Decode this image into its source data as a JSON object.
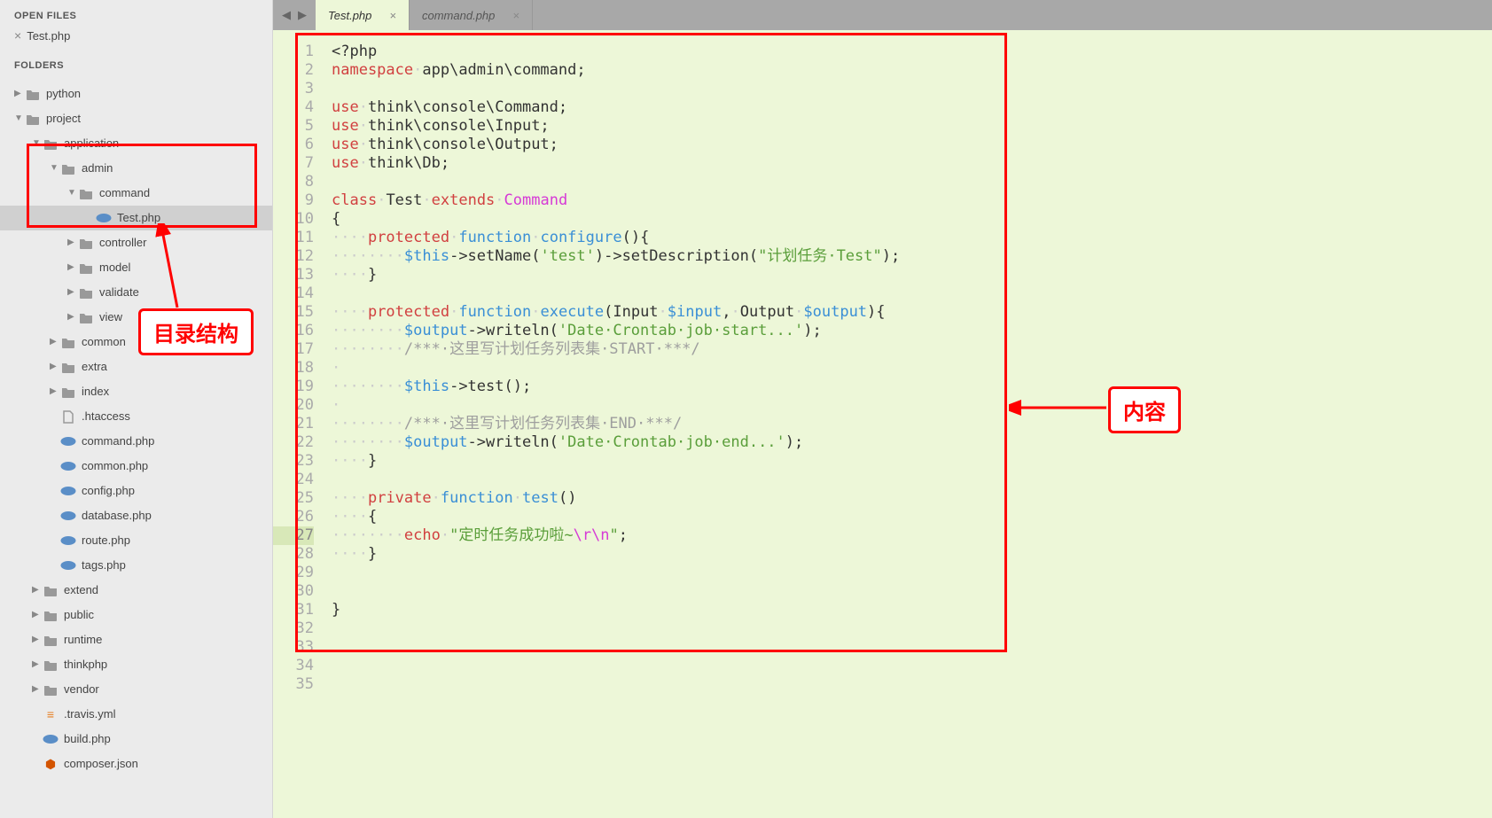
{
  "sidebar": {
    "open_files_header": "OPEN FILES",
    "open_files": [
      {
        "name": "Test.php"
      }
    ],
    "folders_header": "FOLDERS",
    "tree": [
      {
        "label": "python",
        "type": "folder",
        "arrow": "▶",
        "indent": 0
      },
      {
        "label": "project",
        "type": "folder",
        "arrow": "▼",
        "indent": 0
      },
      {
        "label": "application",
        "type": "folder",
        "arrow": "▼",
        "indent": 1
      },
      {
        "label": "admin",
        "type": "folder",
        "arrow": "▼",
        "indent": 2
      },
      {
        "label": "command",
        "type": "folder",
        "arrow": "▼",
        "indent": 3
      },
      {
        "label": "Test.php",
        "type": "php",
        "arrow": "",
        "indent": 4,
        "selected": true
      },
      {
        "label": "controller",
        "type": "folder",
        "arrow": "▶",
        "indent": 3
      },
      {
        "label": "model",
        "type": "folder",
        "arrow": "▶",
        "indent": 3
      },
      {
        "label": "validate",
        "type": "folder",
        "arrow": "▶",
        "indent": 3
      },
      {
        "label": "view",
        "type": "folder",
        "arrow": "▶",
        "indent": 3
      },
      {
        "label": "common",
        "type": "folder",
        "arrow": "▶",
        "indent": 2
      },
      {
        "label": "extra",
        "type": "folder",
        "arrow": "▶",
        "indent": 2
      },
      {
        "label": "index",
        "type": "folder",
        "arrow": "▶",
        "indent": 2
      },
      {
        "label": ".htaccess",
        "type": "file",
        "arrow": "",
        "indent": 2
      },
      {
        "label": "command.php",
        "type": "php",
        "arrow": "",
        "indent": 2
      },
      {
        "label": "common.php",
        "type": "php",
        "arrow": "",
        "indent": 2
      },
      {
        "label": "config.php",
        "type": "php",
        "arrow": "",
        "indent": 2
      },
      {
        "label": "database.php",
        "type": "php",
        "arrow": "",
        "indent": 2
      },
      {
        "label": "route.php",
        "type": "php",
        "arrow": "",
        "indent": 2
      },
      {
        "label": "tags.php",
        "type": "php",
        "arrow": "",
        "indent": 2
      },
      {
        "label": "extend",
        "type": "folder",
        "arrow": "▶",
        "indent": 1
      },
      {
        "label": "public",
        "type": "folder",
        "arrow": "▶",
        "indent": 1
      },
      {
        "label": "runtime",
        "type": "folder",
        "arrow": "▶",
        "indent": 1
      },
      {
        "label": "thinkphp",
        "type": "folder",
        "arrow": "▶",
        "indent": 1
      },
      {
        "label": "vendor",
        "type": "folder",
        "arrow": "▶",
        "indent": 1
      },
      {
        "label": ".travis.yml",
        "type": "yml",
        "arrow": "",
        "indent": 1
      },
      {
        "label": "build.php",
        "type": "php",
        "arrow": "",
        "indent": 1
      },
      {
        "label": "composer.json",
        "type": "json",
        "arrow": "",
        "indent": 1
      }
    ]
  },
  "tabs": [
    {
      "label": "Test.php",
      "active": true
    },
    {
      "label": "command.php",
      "active": false
    }
  ],
  "annotations": {
    "dir_structure": "目录结构",
    "content": "内容"
  },
  "code": {
    "highlighted_line": 27,
    "lines": [
      {
        "n": 1,
        "tokens": [
          [
            "<?php",
            ""
          ]
        ]
      },
      {
        "n": 2,
        "tokens": [
          [
            "namespace",
            "k-red"
          ],
          [
            "·",
            "dot"
          ],
          [
            "app\\admin\\command",
            ""
          ],
          [
            ";",
            ""
          ]
        ]
      },
      {
        "n": 3,
        "tokens": [
          [
            "",
            ""
          ]
        ]
      },
      {
        "n": 4,
        "tokens": [
          [
            "use",
            "k-red"
          ],
          [
            "·",
            "dot"
          ],
          [
            "think\\console\\Command",
            ""
          ],
          [
            ";",
            ""
          ]
        ]
      },
      {
        "n": 5,
        "tokens": [
          [
            "use",
            "k-red"
          ],
          [
            "·",
            "dot"
          ],
          [
            "think\\console\\Input",
            ""
          ],
          [
            ";",
            ""
          ]
        ]
      },
      {
        "n": 6,
        "tokens": [
          [
            "use",
            "k-red"
          ],
          [
            "·",
            "dot"
          ],
          [
            "think\\console\\Output",
            ""
          ],
          [
            ";",
            ""
          ]
        ]
      },
      {
        "n": 7,
        "tokens": [
          [
            "use",
            "k-red"
          ],
          [
            "·",
            "dot"
          ],
          [
            "think\\Db",
            ""
          ],
          [
            ";",
            ""
          ]
        ]
      },
      {
        "n": 8,
        "tokens": [
          [
            "",
            ""
          ]
        ]
      },
      {
        "n": 9,
        "tokens": [
          [
            "class",
            "k-red"
          ],
          [
            "·",
            "dot"
          ],
          [
            "Test",
            ""
          ],
          [
            "·",
            "dot"
          ],
          [
            "extends",
            "k-red"
          ],
          [
            "·",
            "dot"
          ],
          [
            "Command",
            "k-mag"
          ]
        ]
      },
      {
        "n": 10,
        "tokens": [
          [
            "{",
            ""
          ]
        ]
      },
      {
        "n": 11,
        "tokens": [
          [
            "····",
            "dot"
          ],
          [
            "protected",
            "k-red"
          ],
          [
            "·",
            "dot"
          ],
          [
            "function",
            "k-blue"
          ],
          [
            "·",
            "dot"
          ],
          [
            "configure",
            "k-blue"
          ],
          [
            "(){",
            ""
          ]
        ]
      },
      {
        "n": 12,
        "tokens": [
          [
            "········",
            "dot"
          ],
          [
            "$this",
            "k-blue"
          ],
          [
            "->setName(",
            ""
          ],
          [
            "'test'",
            "k-green"
          ],
          [
            ")->setDescription(",
            ""
          ],
          [
            "\"计划任务·Test\"",
            "k-green"
          ],
          [
            ");",
            ""
          ]
        ]
      },
      {
        "n": 13,
        "tokens": [
          [
            "····",
            "dot"
          ],
          [
            "}",
            ""
          ]
        ]
      },
      {
        "n": 14,
        "tokens": [
          [
            "",
            ""
          ]
        ]
      },
      {
        "n": 15,
        "tokens": [
          [
            "····",
            "dot"
          ],
          [
            "protected",
            "k-red"
          ],
          [
            "·",
            "dot"
          ],
          [
            "function",
            "k-blue"
          ],
          [
            "·",
            "dot"
          ],
          [
            "execute",
            "k-blue"
          ],
          [
            "(Input",
            ""
          ],
          [
            "·",
            "dot"
          ],
          [
            "$input",
            "k-blue"
          ],
          [
            ",",
            ""
          ],
          [
            "·",
            "dot"
          ],
          [
            "Output",
            ""
          ],
          [
            "·",
            "dot"
          ],
          [
            "$output",
            "k-blue"
          ],
          [
            "){",
            ""
          ]
        ]
      },
      {
        "n": 16,
        "tokens": [
          [
            "········",
            "dot"
          ],
          [
            "$output",
            "k-blue"
          ],
          [
            "->writeln(",
            ""
          ],
          [
            "'Date·Crontab·job·start...'",
            "k-green"
          ],
          [
            ");",
            ""
          ]
        ]
      },
      {
        "n": 17,
        "tokens": [
          [
            "········",
            "dot"
          ],
          [
            "/***·这里写计划任务列表集·START·***/",
            "k-gray"
          ]
        ]
      },
      {
        "n": 18,
        "tokens": [
          [
            "·",
            "dot"
          ]
        ]
      },
      {
        "n": 19,
        "tokens": [
          [
            "········",
            "dot"
          ],
          [
            "$this",
            "k-blue"
          ],
          [
            "->test();",
            ""
          ]
        ]
      },
      {
        "n": 20,
        "tokens": [
          [
            "·",
            "dot"
          ]
        ]
      },
      {
        "n": 21,
        "tokens": [
          [
            "········",
            "dot"
          ],
          [
            "/***·这里写计划任务列表集·END·***/",
            "k-gray"
          ]
        ]
      },
      {
        "n": 22,
        "tokens": [
          [
            "········",
            "dot"
          ],
          [
            "$output",
            "k-blue"
          ],
          [
            "->writeln(",
            ""
          ],
          [
            "'Date·Crontab·job·end...'",
            "k-green"
          ],
          [
            ");",
            ""
          ]
        ]
      },
      {
        "n": 23,
        "tokens": [
          [
            "····",
            "dot"
          ],
          [
            "}",
            ""
          ]
        ]
      },
      {
        "n": 24,
        "tokens": [
          [
            "",
            ""
          ]
        ]
      },
      {
        "n": 25,
        "tokens": [
          [
            "····",
            "dot"
          ],
          [
            "private",
            "k-red"
          ],
          [
            "·",
            "dot"
          ],
          [
            "function",
            "k-blue"
          ],
          [
            "·",
            "dot"
          ],
          [
            "test",
            "k-blue"
          ],
          [
            "()",
            ""
          ]
        ]
      },
      {
        "n": 26,
        "tokens": [
          [
            "····",
            "dot"
          ],
          [
            "{",
            ""
          ]
        ]
      },
      {
        "n": 27,
        "tokens": [
          [
            "········",
            "dot"
          ],
          [
            "echo",
            "k-red"
          ],
          [
            "·",
            "dot"
          ],
          [
            "\"定时任务成功啦~",
            "k-green"
          ],
          [
            "\\r\\n",
            "k-mag"
          ],
          [
            "\"",
            "k-green"
          ],
          [
            ";",
            ""
          ]
        ]
      },
      {
        "n": 28,
        "tokens": [
          [
            "····",
            "dot"
          ],
          [
            "}",
            ""
          ]
        ]
      },
      {
        "n": 29,
        "tokens": [
          [
            "",
            ""
          ]
        ]
      },
      {
        "n": 30,
        "tokens": [
          [
            "",
            ""
          ]
        ]
      },
      {
        "n": 31,
        "tokens": [
          [
            "}",
            ""
          ]
        ]
      },
      {
        "n": 32,
        "tokens": [
          [
            "",
            ""
          ]
        ]
      },
      {
        "n": 33,
        "tokens": [
          [
            "",
            ""
          ]
        ]
      },
      {
        "n": 34,
        "tokens": [
          [
            "",
            ""
          ]
        ]
      },
      {
        "n": 35,
        "tokens": [
          [
            "",
            ""
          ]
        ]
      }
    ]
  }
}
